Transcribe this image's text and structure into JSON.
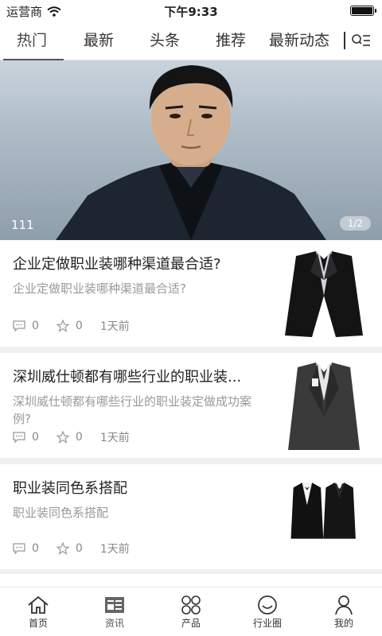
{
  "status_bar": {
    "carrier": "运营商",
    "time": "下午9:33"
  },
  "tabs": [
    "热门",
    "最新",
    "头条",
    "推荐",
    "最新动态"
  ],
  "banner": {
    "caption": "111",
    "pager": "1/2"
  },
  "articles": [
    {
      "title": "企业定做职业装哪种渠道最合适?",
      "summary": "企业定做职业装哪种渠道最合适?",
      "comments": "0",
      "favorites": "0",
      "time": "1天前"
    },
    {
      "title": "深圳威仕顿都有哪些行业的职业装...",
      "summary": "深圳威仕顿都有哪些行业的职业装定做成功案例?",
      "comments": "0",
      "favorites": "0",
      "time": "1天前"
    },
    {
      "title": "职业装同色系搭配",
      "summary": "职业装同色系搭配",
      "comments": "0",
      "favorites": "0",
      "time": "1天前"
    }
  ],
  "bottom_nav": [
    {
      "label": "首页",
      "icon": "home-icon"
    },
    {
      "label": "资讯",
      "icon": "news-icon"
    },
    {
      "label": "产品",
      "icon": "grid-icon"
    },
    {
      "label": "行业圈",
      "icon": "smile-icon"
    },
    {
      "label": "我的",
      "icon": "user-icon"
    }
  ]
}
